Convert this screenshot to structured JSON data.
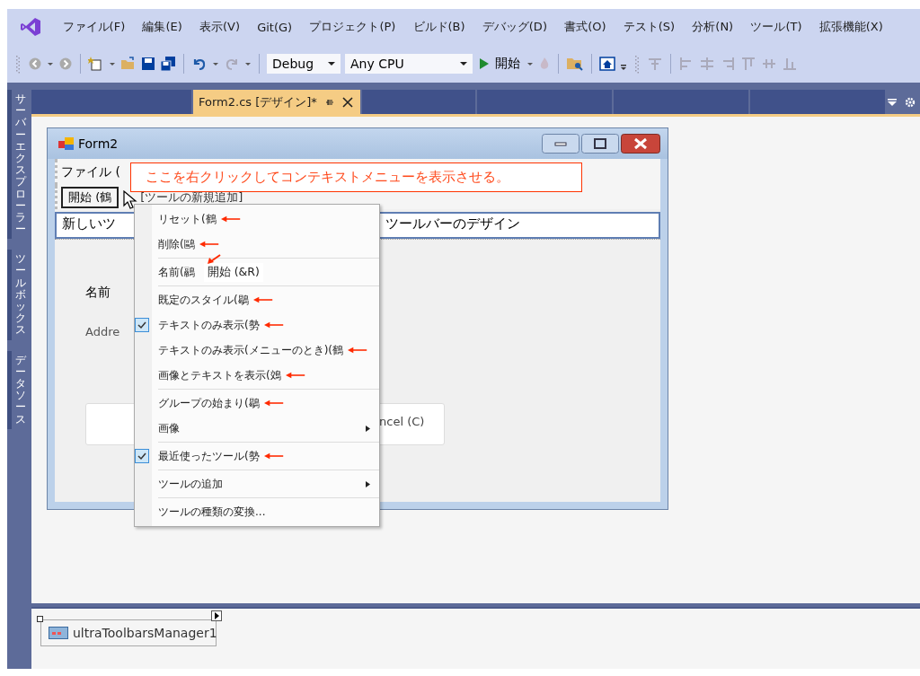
{
  "menu_bar": {
    "items": [
      "ファイル(F)",
      "編集(E)",
      "表示(V)",
      "Git(G)",
      "プロジェクト(P)",
      "ビルド(B)",
      "デバッグ(D)",
      "書式(O)",
      "テスト(S)",
      "分析(N)",
      "ツール(T)",
      "拡張機能(X)"
    ]
  },
  "toolbar": {
    "configuration": "Debug",
    "platform": "Any CPU",
    "start": "開始"
  },
  "side_tabs": [
    "サーバーエクスプローラー",
    "ツールボックス",
    "データソース"
  ],
  "document_tabs": [
    {
      "label": "Form2.cs [デザイン]*",
      "selected": true
    }
  ],
  "form": {
    "title": "Form2",
    "menu_text": "ファイル (",
    "toolbar_item": "開始 (鶴",
    "add_tool": "[ツールの新規追加]",
    "new_toolbar": "新しいツ",
    "design_toolbar": "ツールバーのデザイン",
    "name_label": "名前",
    "address_label": "Addre",
    "cancel_button": "ncel (C)"
  },
  "annotation": "ここを右クリックしてコンテキストメニューを表示させる。",
  "context_menu": {
    "items": [
      {
        "kind": "item",
        "label": "リセット(鶴",
        "arrow": true,
        "checked": false,
        "submenu": false
      },
      {
        "kind": "item",
        "label": "削除(鷗",
        "arrow": true,
        "checked": false,
        "submenu": false
      },
      {
        "kind": "separator"
      },
      {
        "kind": "name",
        "label": "名前(鷊",
        "value": "開始 (&R)",
        "arrow": true
      },
      {
        "kind": "separator"
      },
      {
        "kind": "item",
        "label": "既定のスタイル(鶡",
        "arrow": true,
        "checked": false,
        "submenu": false
      },
      {
        "kind": "item",
        "label": "テキストのみ表示(勢",
        "arrow": true,
        "checked": true,
        "submenu": false
      },
      {
        "kind": "item",
        "label": "テキストのみ表示(メニューのとき)(鶴",
        "arrow": true,
        "checked": false,
        "submenu": false
      },
      {
        "kind": "item",
        "label": "画像とテキストを表示(鵁",
        "arrow": true,
        "checked": false,
        "submenu": false
      },
      {
        "kind": "separator"
      },
      {
        "kind": "item",
        "label": "グループの始まり(鶡",
        "arrow": true,
        "checked": false,
        "submenu": false
      },
      {
        "kind": "item",
        "label": "画像",
        "arrow": false,
        "checked": false,
        "submenu": true
      },
      {
        "kind": "separator"
      },
      {
        "kind": "item",
        "label": "最近使ったツール(勢",
        "arrow": true,
        "checked": true,
        "submenu": false
      },
      {
        "kind": "separator"
      },
      {
        "kind": "item",
        "label": "ツールの追加",
        "arrow": false,
        "checked": false,
        "submenu": true
      },
      {
        "kind": "separator"
      },
      {
        "kind": "item",
        "label": "ツールの種類の変換...",
        "arrow": false,
        "checked": false,
        "submenu": false
      }
    ]
  },
  "component_tray": {
    "items": [
      "ultraToolbarsManager1"
    ]
  }
}
